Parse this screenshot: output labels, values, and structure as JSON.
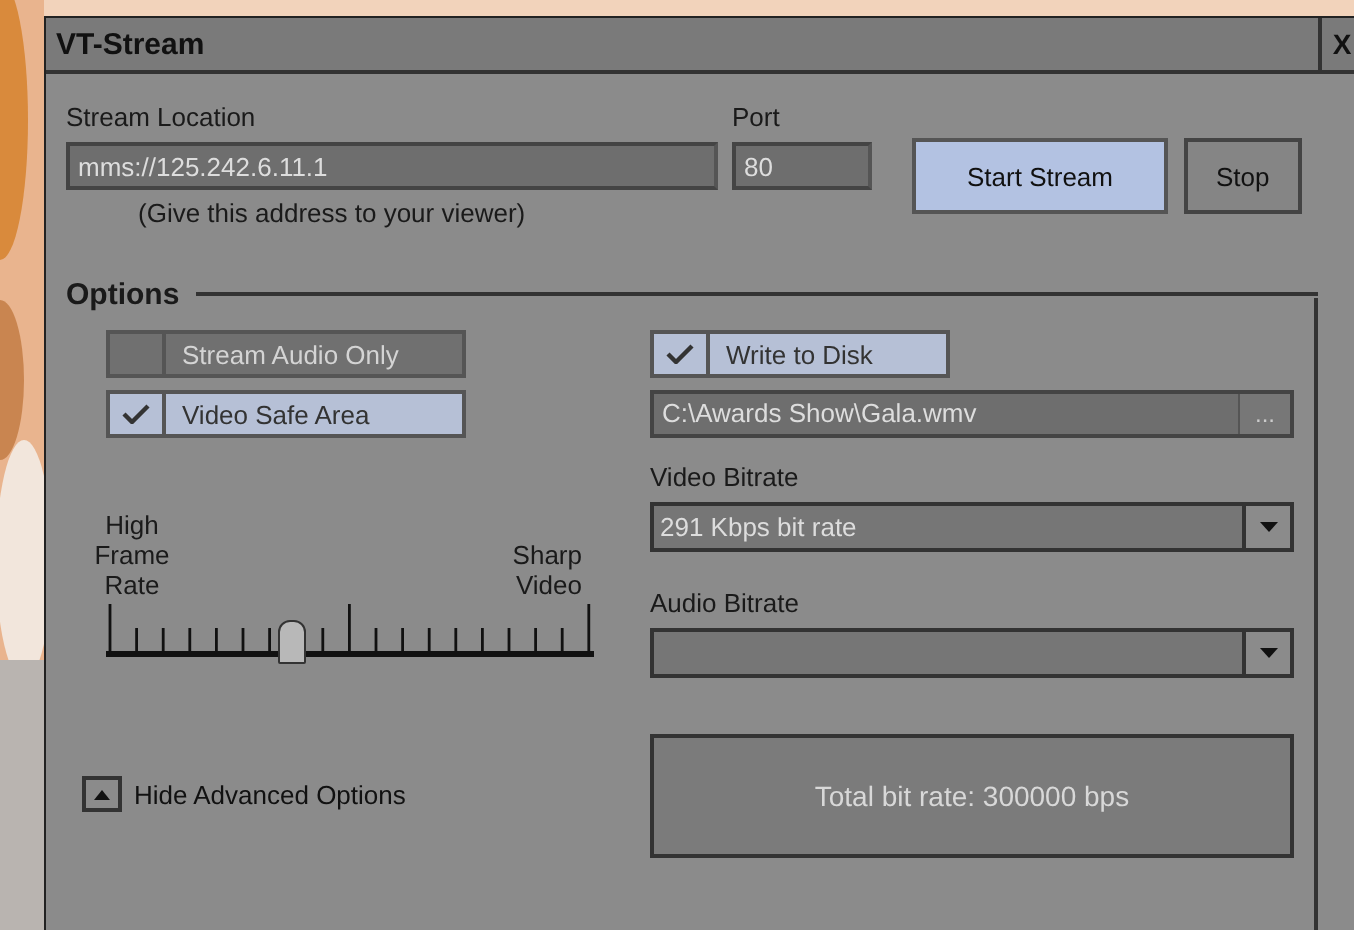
{
  "window": {
    "title": "VT-Stream",
    "close": "X"
  },
  "stream": {
    "location_label": "Stream Location",
    "location": "mms://125.242.6.11.1",
    "port_label": "Port",
    "port": "80",
    "hint": "(Give this address to your viewer)"
  },
  "buttons": [
    {
      "label": "Start Stream",
      "highlighted": true
    },
    {
      "label": "Stop",
      "highlighted": false
    }
  ],
  "options": {
    "title": "Options",
    "checkboxes": [
      {
        "label": "Stream Audio Only",
        "checked": false,
        "disabled": true
      },
      {
        "label": "Video Safe Area",
        "checked": true,
        "disabled": false
      }
    ],
    "slider": {
      "left_label": "High Frame Rate",
      "right_label": "Sharp Video",
      "level": 0.38
    },
    "write_to_disk": {
      "label": "Write to Disk",
      "checked": true
    },
    "file_path": "C:\\Awards Show\\Gala.wmv",
    "browse": "...",
    "video_bitrate_label": "Video Bitrate",
    "video_bitrate": "291 Kbps bit rate",
    "audio_bitrate_label": "Audio Bitrate",
    "total": "Total bit rate: 300000 bps",
    "toggle": "Hide Advanced Options"
  }
}
